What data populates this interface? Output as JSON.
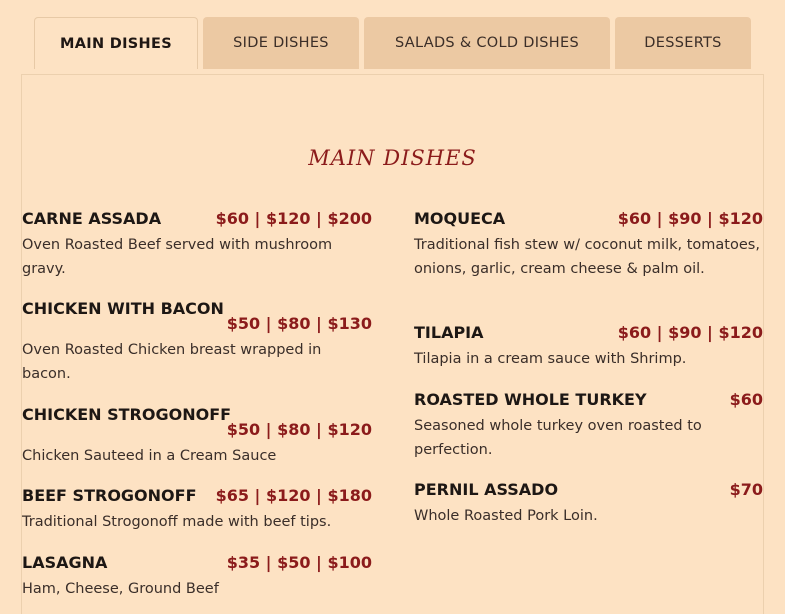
{
  "tabs": [
    {
      "label": "MAIN DISHES",
      "active": true
    },
    {
      "label": "SIDE DISHES",
      "active": false
    },
    {
      "label": "SALADS & COLD DISHES",
      "active": false
    },
    {
      "label": "DESSERTS",
      "active": false
    }
  ],
  "section_title": "MAIN DISHES",
  "left_items": [
    {
      "name": "CARNE ASSADA",
      "price": "$60 | $120 | $200",
      "desc": "Oven Roasted Beef served with mushroom gravy."
    },
    {
      "name": "CHICKEN WITH BACON",
      "price": "$50 | $80 | $130",
      "desc": "Oven Roasted Chicken breast wrapped in bacon."
    },
    {
      "name": "CHICKEN STROGONOFF",
      "price": "$50 | $80 | $120",
      "desc": "Chicken Sauteed in a Cream Sauce"
    },
    {
      "name": "BEEF STROGONOFF",
      "price": "$65 | $120 | $180",
      "desc": "Traditional Strogonoff made with beef tips."
    },
    {
      "name": "LASAGNA",
      "price": "$35 | $50 | $100",
      "desc": "Ham, Cheese, Ground Beef"
    }
  ],
  "right_items": [
    {
      "name": "MOQUECA",
      "price": "$60 | $90 | $120",
      "desc": "Traditional fish stew w/ coconut milk, tomatoes, onions, garlic, cream cheese & palm oil."
    },
    {
      "name": "TILAPIA",
      "price": "$60 | $90 | $120",
      "desc": "Tilapia in a cream sauce with Shrimp."
    },
    {
      "name": "ROASTED WHOLE TURKEY",
      "price": "$60",
      "desc": "Seasoned whole turkey oven roasted to perfection."
    },
    {
      "name": "PERNIL ASSADO",
      "price": "$70",
      "desc": "Whole Roasted Pork Loin."
    }
  ]
}
